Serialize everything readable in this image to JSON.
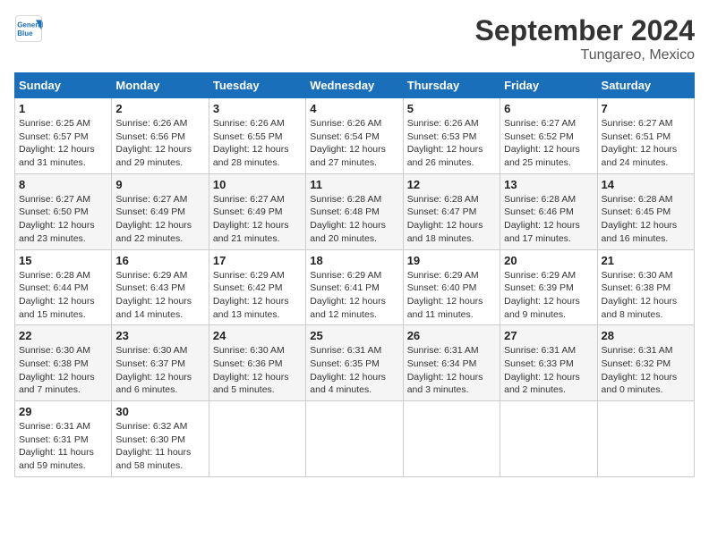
{
  "logo": {
    "line1": "General",
    "line2": "Blue"
  },
  "title": "September 2024",
  "location": "Tungareo, Mexico",
  "days_of_week": [
    "Sunday",
    "Monday",
    "Tuesday",
    "Wednesday",
    "Thursday",
    "Friday",
    "Saturday"
  ],
  "weeks": [
    [
      {
        "day": "1",
        "sunrise": "6:25 AM",
        "sunset": "6:57 PM",
        "daylight": "12 hours and 31 minutes."
      },
      {
        "day": "2",
        "sunrise": "6:26 AM",
        "sunset": "6:56 PM",
        "daylight": "12 hours and 29 minutes."
      },
      {
        "day": "3",
        "sunrise": "6:26 AM",
        "sunset": "6:55 PM",
        "daylight": "12 hours and 28 minutes."
      },
      {
        "day": "4",
        "sunrise": "6:26 AM",
        "sunset": "6:54 PM",
        "daylight": "12 hours and 27 minutes."
      },
      {
        "day": "5",
        "sunrise": "6:26 AM",
        "sunset": "6:53 PM",
        "daylight": "12 hours and 26 minutes."
      },
      {
        "day": "6",
        "sunrise": "6:27 AM",
        "sunset": "6:52 PM",
        "daylight": "12 hours and 25 minutes."
      },
      {
        "day": "7",
        "sunrise": "6:27 AM",
        "sunset": "6:51 PM",
        "daylight": "12 hours and 24 minutes."
      }
    ],
    [
      {
        "day": "8",
        "sunrise": "6:27 AM",
        "sunset": "6:50 PM",
        "daylight": "12 hours and 23 minutes."
      },
      {
        "day": "9",
        "sunrise": "6:27 AM",
        "sunset": "6:49 PM",
        "daylight": "12 hours and 22 minutes."
      },
      {
        "day": "10",
        "sunrise": "6:27 AM",
        "sunset": "6:49 PM",
        "daylight": "12 hours and 21 minutes."
      },
      {
        "day": "11",
        "sunrise": "6:28 AM",
        "sunset": "6:48 PM",
        "daylight": "12 hours and 20 minutes."
      },
      {
        "day": "12",
        "sunrise": "6:28 AM",
        "sunset": "6:47 PM",
        "daylight": "12 hours and 18 minutes."
      },
      {
        "day": "13",
        "sunrise": "6:28 AM",
        "sunset": "6:46 PM",
        "daylight": "12 hours and 17 minutes."
      },
      {
        "day": "14",
        "sunrise": "6:28 AM",
        "sunset": "6:45 PM",
        "daylight": "12 hours and 16 minutes."
      }
    ],
    [
      {
        "day": "15",
        "sunrise": "6:28 AM",
        "sunset": "6:44 PM",
        "daylight": "12 hours and 15 minutes."
      },
      {
        "day": "16",
        "sunrise": "6:29 AM",
        "sunset": "6:43 PM",
        "daylight": "12 hours and 14 minutes."
      },
      {
        "day": "17",
        "sunrise": "6:29 AM",
        "sunset": "6:42 PM",
        "daylight": "12 hours and 13 minutes."
      },
      {
        "day": "18",
        "sunrise": "6:29 AM",
        "sunset": "6:41 PM",
        "daylight": "12 hours and 12 minutes."
      },
      {
        "day": "19",
        "sunrise": "6:29 AM",
        "sunset": "6:40 PM",
        "daylight": "12 hours and 11 minutes."
      },
      {
        "day": "20",
        "sunrise": "6:29 AM",
        "sunset": "6:39 PM",
        "daylight": "12 hours and 9 minutes."
      },
      {
        "day": "21",
        "sunrise": "6:30 AM",
        "sunset": "6:38 PM",
        "daylight": "12 hours and 8 minutes."
      }
    ],
    [
      {
        "day": "22",
        "sunrise": "6:30 AM",
        "sunset": "6:38 PM",
        "daylight": "12 hours and 7 minutes."
      },
      {
        "day": "23",
        "sunrise": "6:30 AM",
        "sunset": "6:37 PM",
        "daylight": "12 hours and 6 minutes."
      },
      {
        "day": "24",
        "sunrise": "6:30 AM",
        "sunset": "6:36 PM",
        "daylight": "12 hours and 5 minutes."
      },
      {
        "day": "25",
        "sunrise": "6:31 AM",
        "sunset": "6:35 PM",
        "daylight": "12 hours and 4 minutes."
      },
      {
        "day": "26",
        "sunrise": "6:31 AM",
        "sunset": "6:34 PM",
        "daylight": "12 hours and 3 minutes."
      },
      {
        "day": "27",
        "sunrise": "6:31 AM",
        "sunset": "6:33 PM",
        "daylight": "12 hours and 2 minutes."
      },
      {
        "day": "28",
        "sunrise": "6:31 AM",
        "sunset": "6:32 PM",
        "daylight": "12 hours and 0 minutes."
      }
    ],
    [
      {
        "day": "29",
        "sunrise": "6:31 AM",
        "sunset": "6:31 PM",
        "daylight": "11 hours and 59 minutes."
      },
      {
        "day": "30",
        "sunrise": "6:32 AM",
        "sunset": "6:30 PM",
        "daylight": "11 hours and 58 minutes."
      },
      null,
      null,
      null,
      null,
      null
    ]
  ],
  "labels": {
    "sunrise": "Sunrise:",
    "sunset": "Sunset:",
    "daylight": "Daylight:"
  }
}
